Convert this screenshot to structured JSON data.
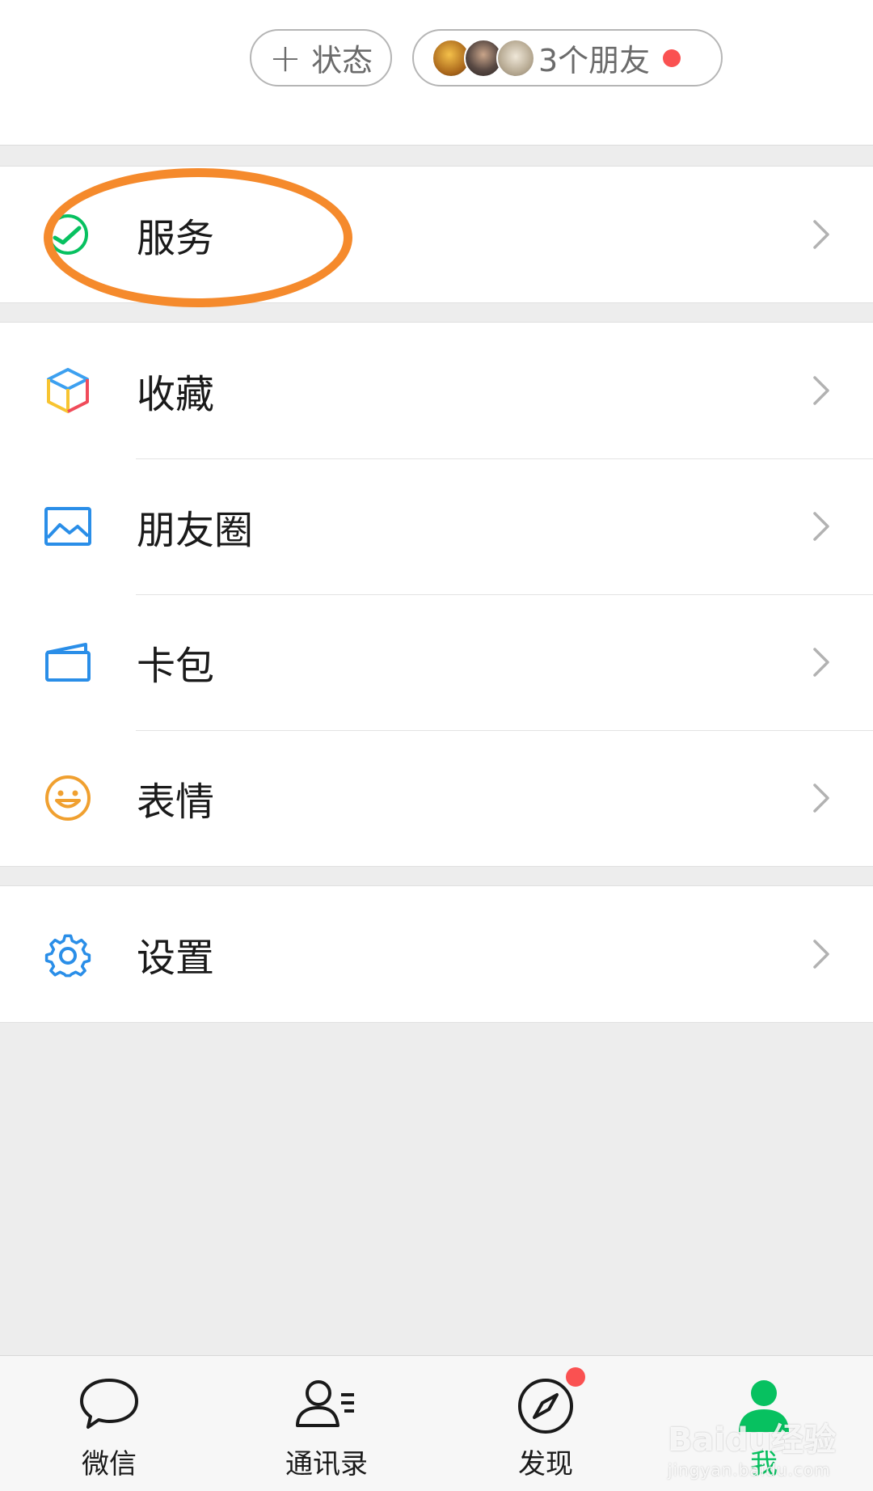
{
  "header": {
    "status_label": "状态",
    "friends_label": "3个朋友"
  },
  "menu": {
    "services": "服务",
    "favorites": "收藏",
    "moments": "朋友圈",
    "cards": "卡包",
    "stickers": "表情",
    "settings": "设置"
  },
  "tabbar": {
    "chats": "微信",
    "contacts": "通讯录",
    "discover": "发现",
    "me": "我"
  },
  "watermark": {
    "brand": "Baidu经验",
    "url": "jingyan.baidu.com"
  },
  "colors": {
    "accent_green": "#07c160",
    "badge_red": "#fa5151",
    "annotation_orange": "#f58a2c"
  }
}
